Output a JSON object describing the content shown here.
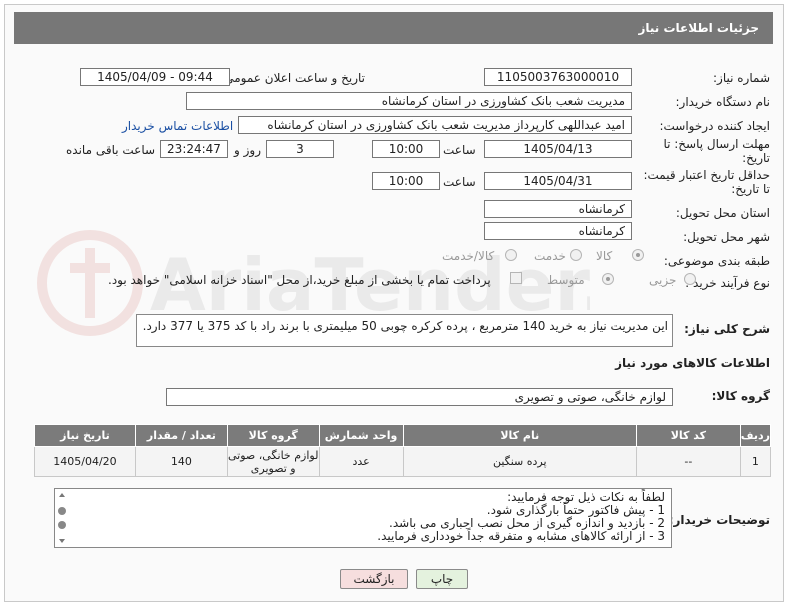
{
  "header": {
    "title": "جزئیات اطلاعات نیاز"
  },
  "fields": {
    "need_number_label": "شماره نیاز:",
    "need_number": "1105003763000010",
    "announce_label": "تاریخ و ساعت اعلان عمومی:",
    "announce_value": "1405/04/09 - 09:44",
    "buyer_org_label": "نام دستگاه خریدار:",
    "buyer_org": "مدیریت شعب بانک کشاورزی در استان کرمانشاه",
    "requester_label": "ایجاد کننده درخواست:",
    "requester": "امید عبداللهی  کارپرداز مدیریت شعب بانک کشاورزی در استان کرمانشاه",
    "contact_link": "اطلاعات تماس خریدار",
    "deadline_label_1": "مهلت ارسال پاسخ: تا",
    "deadline_label_2": "تاریخ:",
    "deadline_date": "1405/04/13",
    "time_label": "ساعت",
    "deadline_time": "10:00",
    "days_value": "3",
    "days_label": "روز و",
    "remaining_value": "23:24:47",
    "remaining_label": "ساعت باقی مانده",
    "price_label_1": "حداقل تاریخ اعتبار قیمت:",
    "price_label_2": "تا تاریخ:",
    "price_date": "1405/04/31",
    "price_time": "10:00",
    "province_label": "استان محل تحویل:",
    "province": "کرمانشاه",
    "city_label": "شهر محل تحویل:",
    "city": "کرمانشاه",
    "category_label": "طبقه بندی موضوعی:",
    "category_options": [
      "کالا",
      "خدمت",
      "کالا/خدمت"
    ],
    "process_label": "نوع فرآیند خرید :",
    "process_options": [
      "جزیی",
      "متوسط"
    ],
    "payment_note": "پرداخت تمام یا بخشی از مبلغ خرید،از محل \"اسناد خزانه اسلامی\" خواهد بود.",
    "description_label": "شرح کلی نیاز:",
    "description": "این مدیریت نیاز به خرید 140 مترمربع ، پرده کرکره چوبی 50 میلیمتری با برند راد با کد 375 یا 377 دارد.",
    "goods_info_title": "اطلاعات کالاهای مورد نیاز",
    "goods_group_label": "گروه کالا:",
    "goods_group": "لوازم خانگی، صوتی و تصویری"
  },
  "table": {
    "headers": [
      "ردیف",
      "کد کالا",
      "نام کالا",
      "واحد شمارش",
      "گروه کالا",
      "تعداد / مقدار",
      "تاریخ نیاز"
    ],
    "rows": [
      [
        "1",
        "--",
        "پرده سنگین",
        "عدد",
        "لوازم خانگی، صوتی و تصویری",
        "140",
        "1405/04/20"
      ]
    ]
  },
  "notes": {
    "label": "توضیحات خریدار:",
    "lines": [
      "لطفاً به نکات ذیل توجه فرمایید:",
      "1 - پیش فاکتور حتماً بارگذاری شود.",
      "2 - بازدید و اندازه گیری از محل نصب اجباری می باشد.",
      "3 - از ارائه کالاهای مشابه و متفرقه جداً خودداری فرمایید."
    ]
  },
  "buttons": {
    "print": "چاپ",
    "back": "بازگشت"
  },
  "watermark": {
    "text": "AriaTender.neT"
  },
  "colors": {
    "header_bg": "#777777",
    "link": "#1a4fa3",
    "back_bg": "#f6dede",
    "print_bg": "#e4f2de"
  }
}
